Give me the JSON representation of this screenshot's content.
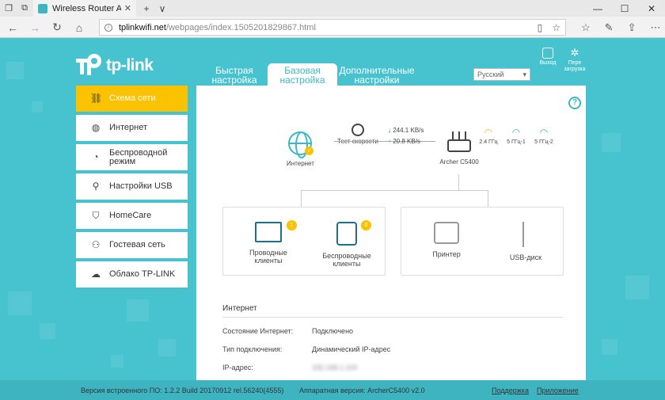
{
  "browser": {
    "tab_title": "Wireless Router Archer",
    "url_host": "tplinkwifi.net",
    "url_path": "/webpages/index.1505201829867.html",
    "new_tab": "+",
    "tab_list": "∨"
  },
  "header": {
    "logo_text": "tp-link",
    "tabs": [
      {
        "label": "Быстрая настройка"
      },
      {
        "label": "Базовая настройка"
      },
      {
        "label": "Дополнительные настройки"
      }
    ],
    "language": "Русский",
    "logout_label": "Выход",
    "reboot_label": "Пере загрузка"
  },
  "sidebar": {
    "items": [
      {
        "label": "Схема сети"
      },
      {
        "label": "Интернет"
      },
      {
        "label": "Беспроводной режим"
      },
      {
        "label": "Настройки USB"
      },
      {
        "label": "HomeCare"
      },
      {
        "label": "Гостевая сеть"
      },
      {
        "label": "Облако TP-LINK"
      }
    ]
  },
  "network": {
    "internet_label": "Интернет",
    "speed_test_label": "Тест скорости",
    "download": "244.1 KB/s",
    "upload": "20.8 KB/s",
    "router_label": "Archer C5400",
    "bands": [
      "2.4 ГГц",
      "5 ГГц-1",
      "5 ГГц-2"
    ],
    "wired_clients": "Проводные клиенты",
    "wired_count": "1",
    "wireless_clients": "Беспроводные клиенты",
    "wireless_count": "0",
    "printer": "Принтер",
    "usb_disk": "USB-диск"
  },
  "internet_info": {
    "title": "Интернет",
    "rows": [
      {
        "label": "Состояние Интернет:",
        "value": "Подключено"
      },
      {
        "label": "Тип подключения:",
        "value": "Динамический IP-адрес"
      },
      {
        "label": "IP-адрес:",
        "value": "192.168.1.100"
      }
    ]
  },
  "footer": {
    "firmware": "Версия встроенного ПО: 1.2.2 Build 20170912 rel.56240(4555)",
    "hardware": "Аппаратная версия: ArcherC5400 v2.0",
    "support": "Поддержка",
    "app": "Приложение"
  },
  "colors": {
    "accent": "#47c3d0",
    "active": "#fac200"
  }
}
